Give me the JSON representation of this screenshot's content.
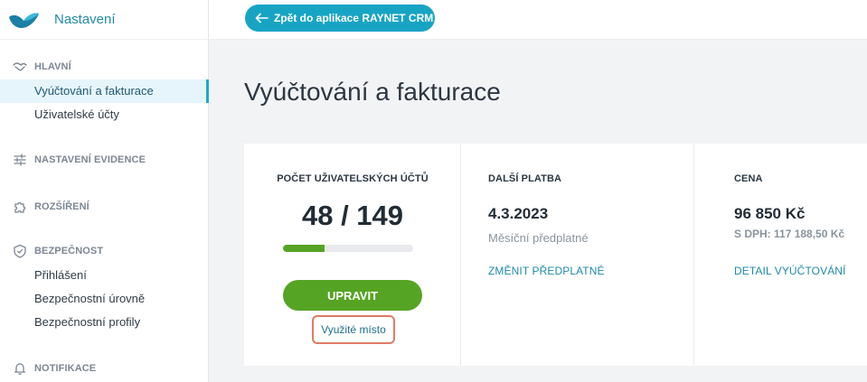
{
  "app": {
    "title": "Nastavení"
  },
  "colors": {
    "accent": "#17a4c3",
    "green": "#56a423",
    "highlight": "#e07b66"
  },
  "back_button": {
    "label": "Zpět do aplikace RAYNET CRM",
    "icon": "arrow-left-icon"
  },
  "page": {
    "title": "Vyúčtování a fakturace"
  },
  "sidebar": {
    "sections": [
      {
        "label": "HLAVNÍ",
        "icon": "handshake-icon",
        "items": [
          "Vyúčtování a fakturace",
          "Uživatelské účty"
        ]
      },
      {
        "label": "NASTAVENÍ EVIDENCE",
        "icon": "sliders-icon",
        "items": []
      },
      {
        "label": "ROZŠÍŘENÍ",
        "icon": "puzzle-icon",
        "items": []
      },
      {
        "label": "BEZPEČNOST",
        "icon": "shield-icon",
        "items": [
          "Přihlášení",
          "Bezpečnostní úrovně",
          "Bezpečnostní profily"
        ]
      },
      {
        "label": "NOTIFIKACE",
        "icon": "bell-icon",
        "items": []
      }
    ],
    "active_item": "Vyúčtování a fakturace"
  },
  "billing": {
    "users": {
      "label": "POČET UŽIVATELSKÝCH ÚČTŮ",
      "count": "48 / 149",
      "progress_fraction": 0.322,
      "button": "UPRAVIT",
      "link": "Využité místo"
    },
    "next_payment": {
      "label": "DALŠÍ PLATBA",
      "date": "4.3.2023",
      "plan": "Měsíční předplatné",
      "link": "ZMĚNIT PŘEDPLATNÉ"
    },
    "price": {
      "label": "CENA",
      "amount": "96 850 Kč",
      "vat": "S DPH: 117 188,50 Kč",
      "link": "DETAIL VYÚČTOVÁNÍ"
    }
  }
}
